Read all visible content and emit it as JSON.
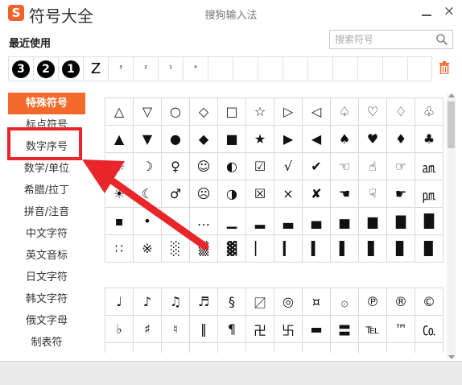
{
  "app": {
    "logo": "S",
    "name": "符号大全",
    "window_title": "搜狗输入法",
    "close_glyph": "×"
  },
  "recent": {
    "label": "最近使用",
    "items": [
      {
        "glyph": "3",
        "type": "black-circle-number"
      },
      {
        "glyph": "2",
        "type": "black-circle-number"
      },
      {
        "glyph": "1",
        "type": "black-circle-number"
      },
      {
        "glyph": "Z",
        "type": "text"
      },
      {
        "glyph": "³",
        "type": "small"
      },
      {
        "glyph": "²",
        "type": "small"
      },
      {
        "glyph": "¹",
        "type": "small"
      },
      {
        "glyph": "°",
        "type": "small"
      },
      {
        "glyph": "",
        "type": "small"
      },
      {
        "glyph": "",
        "type": "small"
      },
      {
        "glyph": "",
        "type": "small"
      },
      {
        "glyph": "",
        "type": "small"
      },
      {
        "glyph": "",
        "type": "small"
      },
      {
        "glyph": "",
        "type": "small"
      },
      {
        "glyph": "",
        "type": "small"
      },
      {
        "glyph": "",
        "type": "small"
      },
      {
        "glyph": "",
        "type": "small"
      }
    ]
  },
  "search": {
    "placeholder": "搜索符号"
  },
  "sidebar": {
    "items": [
      {
        "label": "特殊符号",
        "active": true
      },
      {
        "label": "标点符号",
        "active": false
      },
      {
        "label": "数字序号",
        "active": false
      },
      {
        "label": "数学/单位",
        "active": false
      },
      {
        "label": "希腊/拉丁",
        "active": false
      },
      {
        "label": "拼音/注音",
        "active": false
      },
      {
        "label": "中文字符",
        "active": false
      },
      {
        "label": "英文音标",
        "active": false
      },
      {
        "label": "日文字符",
        "active": false
      },
      {
        "label": "韩文字符",
        "active": false
      },
      {
        "label": "俄文字母",
        "active": false
      },
      {
        "label": "制表符",
        "active": false
      }
    ]
  },
  "grid1": [
    [
      "△",
      "▽",
      "○",
      "◇",
      "□",
      "☆",
      "▷",
      "◁",
      "♤",
      "♡",
      "♢",
      "♧"
    ],
    [
      "▲",
      "▼",
      "●",
      "◆",
      "■",
      "★",
      "▶",
      "◀",
      "♠",
      "♥",
      "♦",
      "♣"
    ],
    [
      "☼",
      "☽",
      "♀",
      "☺",
      "◐",
      "☑",
      "√",
      "✔",
      "☜",
      "☝",
      "☞",
      "㏂"
    ],
    [
      "☀",
      "☾",
      "♂",
      "☹",
      "◑",
      "☒",
      "×",
      "✘",
      "☚",
      "☟",
      "☛",
      "㏘"
    ],
    [
      "▪",
      "•",
      "‥",
      "…",
      "▁",
      "▂",
      "▃",
      "▄",
      "▅",
      "▆",
      "▇",
      "█"
    ],
    [
      "∷",
      "※",
      "░",
      "▒",
      "▓",
      "▏",
      "▎",
      "▍",
      "▌",
      "▋",
      "▊",
      "▉"
    ]
  ],
  "grid2": [
    [
      "♩",
      "♪",
      "♫",
      "♬",
      "§",
      "〼",
      "◎",
      "¤",
      "۞",
      "℗",
      "®",
      "©"
    ],
    [
      "♭",
      "♯",
      "♮",
      "‖",
      "¶",
      "卍",
      "卐",
      "▬",
      "〓",
      "℡",
      "™",
      "㏇"
    ],
    [
      "",
      "",
      "",
      "",
      "",
      "",
      "",
      "",
      "",
      "",
      "",
      ""
    ]
  ],
  "colors": {
    "accent": "#f36a2a",
    "highlight_box": "#e8262a",
    "arrow": "#e8262a"
  }
}
